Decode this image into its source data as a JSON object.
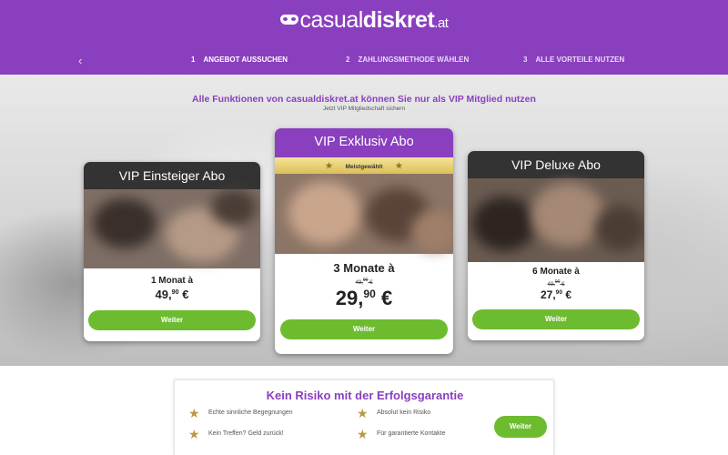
{
  "header": {
    "logo": {
      "prefix": "casual",
      "bold": "diskret",
      "tld": ".at"
    },
    "back_arrow": "‹",
    "steps": [
      {
        "num": "1",
        "label": "ANGEBOT AUSSUCHEN",
        "active": true
      },
      {
        "num": "2",
        "label": "ZAHLUNGSMETHODE WÄHLEN",
        "active": false
      },
      {
        "num": "3",
        "label": "ALLE VORTEILE NUTZEN",
        "active": false
      }
    ]
  },
  "hero": {
    "headline": "Alle Funktionen von casualdiskret.at können Sie nur als VIP Mitglied nutzen",
    "subline": "Jetzt VIP Mitgliedschaft sichern"
  },
  "plans": [
    {
      "title": "VIP Einsteiger Abo",
      "duration": "1 Monat à",
      "price_main": "49,",
      "price_cents": "90",
      "currency": "€",
      "button": "Weiter"
    },
    {
      "title": "VIP Exklusiv Abo",
      "ribbon": "Meistgewählt",
      "ribbon_star": "★",
      "duration": "3 Monate à",
      "old_main": "49,",
      "old_cents": "90",
      "old_currency": "€",
      "price_main": "29,",
      "price_cents": "90",
      "currency": "€",
      "button": "Weiter"
    },
    {
      "title": "VIP Deluxe Abo",
      "duration": "6 Monate à",
      "old_main": "49,",
      "old_cents": "90",
      "old_currency": "€",
      "price_main": "27,",
      "price_cents": "90",
      "currency": "€",
      "button": "Weiter"
    }
  ],
  "guarantee": {
    "title": "Kein Risiko mit der Erfolgsgarantie",
    "star": "★",
    "items": [
      "Echte sinnliche Begegnungen",
      "Absolut kein Risiko",
      "Kein Treffen? Geld zurück!",
      "Für garantierte Kontakte"
    ],
    "button": "Weiter"
  },
  "colors": {
    "brand_purple": "#8a3fbf",
    "cta_green": "#6dbb2f",
    "card_header_dark": "#333333",
    "ribbon_gold": "#e6cd6a"
  }
}
